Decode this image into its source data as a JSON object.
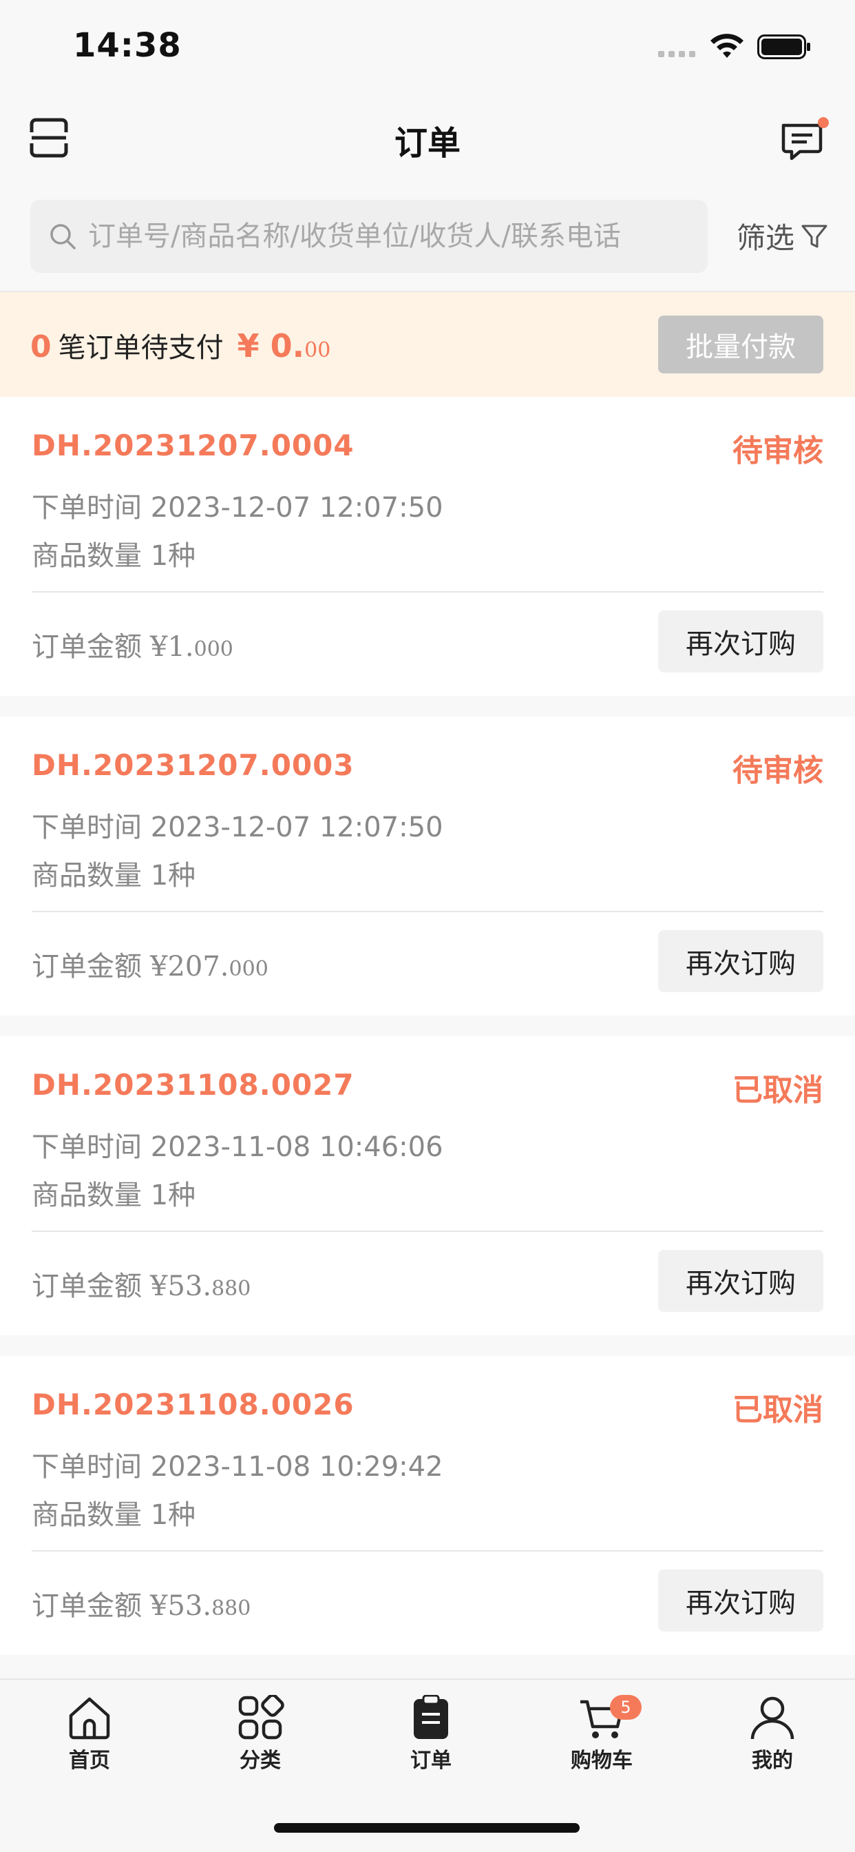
{
  "status_bar": {
    "time": "14:38"
  },
  "nav": {
    "title": "订单"
  },
  "search": {
    "placeholder": "订单号/商品名称/收货单位/收货人/联系电话",
    "filter_label": "筛选"
  },
  "pay_banner": {
    "count": "0",
    "text": "笔订单待支付",
    "amount_prefix": "¥ 0.",
    "amount_cents": "00",
    "button_label": "批量付款"
  },
  "orders": [
    {
      "order_no": "DH.20231207.0004",
      "status": "待审核",
      "time_label": "下单时间",
      "time": "2023-12-07 12:07:50",
      "qty_label": "商品数量",
      "qty": "1种",
      "amount_label": "订单金额",
      "amount_main": "¥1.",
      "amount_cents": "000",
      "reorder_label": "再次订购"
    },
    {
      "order_no": "DH.20231207.0003",
      "status": "待审核",
      "time_label": "下单时间",
      "time": "2023-12-07 12:07:50",
      "qty_label": "商品数量",
      "qty": "1种",
      "amount_label": "订单金额",
      "amount_main": "¥207.",
      "amount_cents": "000",
      "reorder_label": "再次订购"
    },
    {
      "order_no": "DH.20231108.0027",
      "status": "已取消",
      "time_label": "下单时间",
      "time": "2023-11-08 10:46:06",
      "qty_label": "商品数量",
      "qty": "1种",
      "amount_label": "订单金额",
      "amount_main": "¥53.",
      "amount_cents": "880",
      "reorder_label": "再次订购"
    },
    {
      "order_no": "DH.20231108.0026",
      "status": "已取消",
      "time_label": "下单时间",
      "time": "2023-11-08 10:29:42",
      "qty_label": "商品数量",
      "qty": "1种",
      "amount_label": "订单金额",
      "amount_main": "¥53.",
      "amount_cents": "880",
      "reorder_label": "再次订购"
    }
  ],
  "tab_bar": {
    "home": "首页",
    "category": "分类",
    "orders": "订单",
    "cart": "购物车",
    "cart_badge": "5",
    "me": "我的"
  },
  "colors": {
    "accent": "#f47a5a",
    "banner_bg": "#fef3e5",
    "disabled_button": "#c4c4c4"
  }
}
